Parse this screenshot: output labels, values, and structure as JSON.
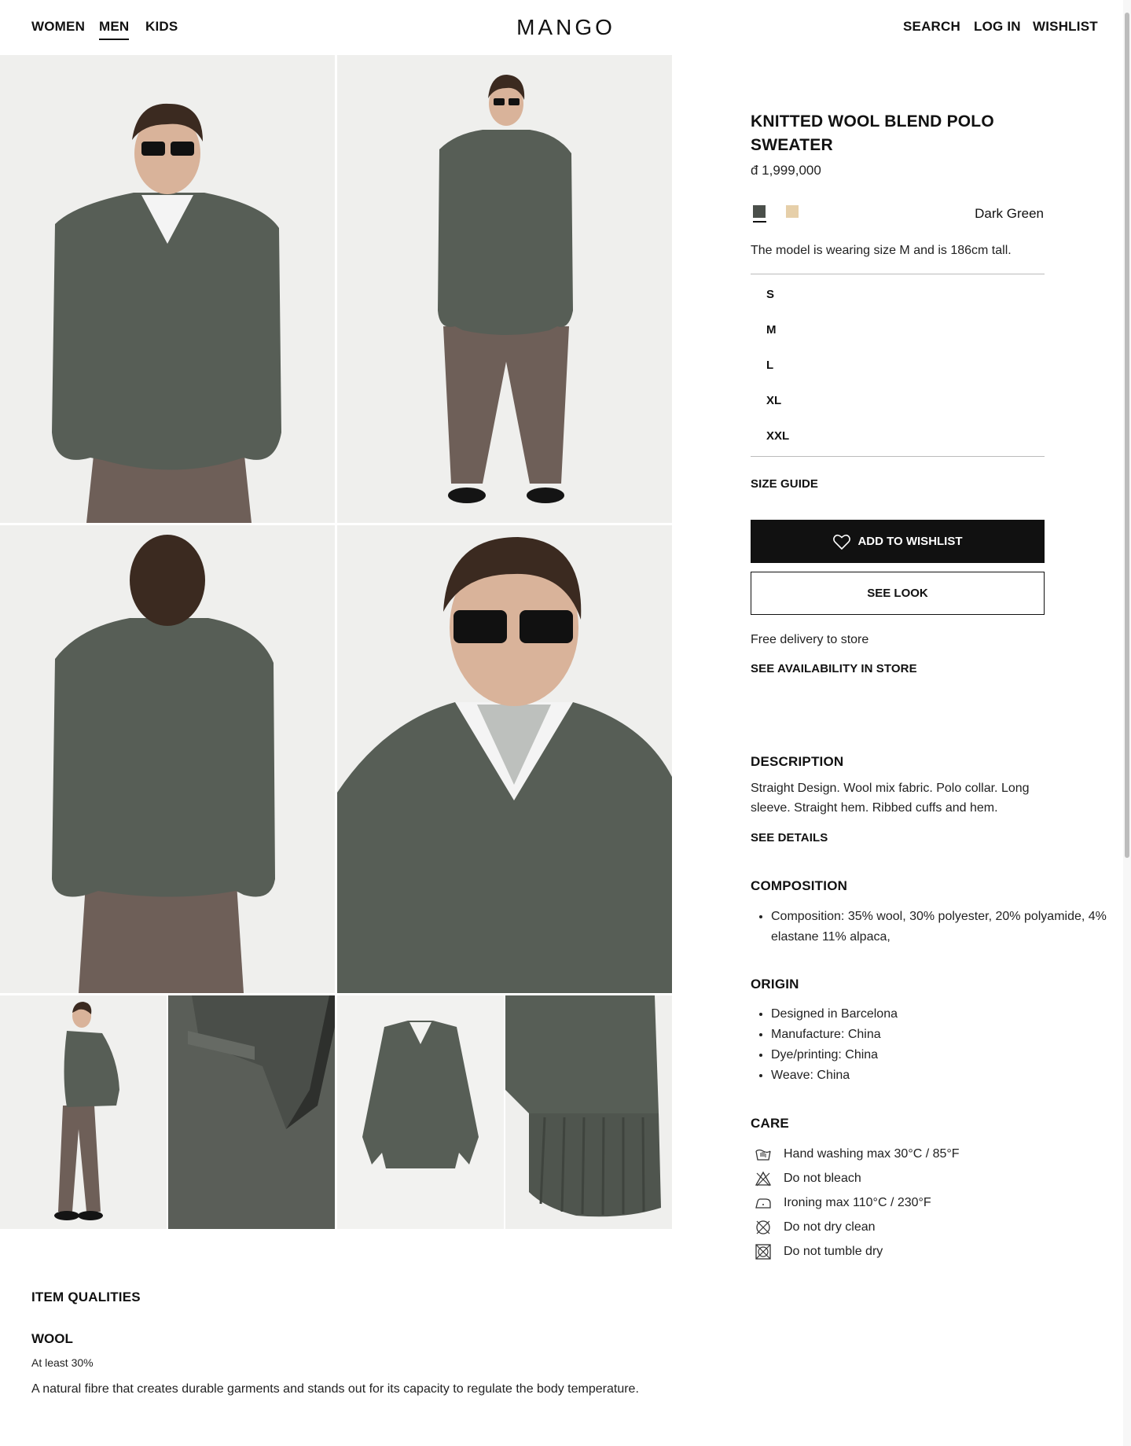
{
  "header": {
    "nav": [
      "WOMEN",
      "MEN",
      "KIDS"
    ],
    "active_nav": "MEN",
    "brand": "MANGO",
    "actions": [
      "SEARCH",
      "LOG IN",
      "WISHLIST"
    ]
  },
  "product": {
    "title": "KNITTED WOOL BLEND POLO SWEATER",
    "price": "đ 1,999,000",
    "colors": [
      {
        "name": "Dark Green",
        "hex": "#4a4f4a",
        "selected": true
      },
      {
        "name": "Beige",
        "hex": "#e6cfa9",
        "selected": false
      }
    ],
    "selected_color": "Dark Green",
    "model_info": "The model is wearing size M and is 186cm tall.",
    "sizes": [
      "S",
      "M",
      "L",
      "XL",
      "XXL"
    ],
    "size_guide": "SIZE GUIDE",
    "wishlist_button": "ADD TO WISHLIST",
    "see_look_button": "SEE LOOK",
    "delivery": "Free delivery to store",
    "availability_link": "SEE AVAILABILITY IN STORE"
  },
  "description": {
    "heading": "DESCRIPTION",
    "text": "Straight Design. Wool mix fabric. Polo collar. Long sleeve. Straight hem. Ribbed cuffs and hem.",
    "details_link": "SEE DETAILS"
  },
  "composition": {
    "heading": "COMPOSITION",
    "items": [
      "Composition: 35% wool, 30% polyester, 20% polyamide, 4% elastane  11% alpaca,"
    ]
  },
  "origin": {
    "heading": "ORIGIN",
    "items": [
      "Designed in Barcelona",
      "Manufacture: China",
      "Dye/printing: China",
      "Weave: China"
    ]
  },
  "care": {
    "heading": "CARE",
    "items": [
      {
        "icon": "hand-wash-icon",
        "text": "Hand washing max 30°C / 85°F"
      },
      {
        "icon": "no-bleach-icon",
        "text": "Do not bleach"
      },
      {
        "icon": "iron-icon",
        "text": "Ironing max 110°C / 230°F"
      },
      {
        "icon": "no-dry-clean-icon",
        "text": "Do not dry clean"
      },
      {
        "icon": "no-tumble-dry-icon",
        "text": "Do not tumble dry"
      }
    ]
  },
  "qualities": {
    "heading": "ITEM QUALITIES",
    "name": "WOOL",
    "amount": "At least 30%",
    "text": "A natural fibre that creates durable garments and stands out for its capacity to regulate the body temperature."
  },
  "colors": {
    "sweater": "#575e56",
    "trousers": "#6e5f58",
    "background": "#eeeeec",
    "text": "#111111"
  }
}
